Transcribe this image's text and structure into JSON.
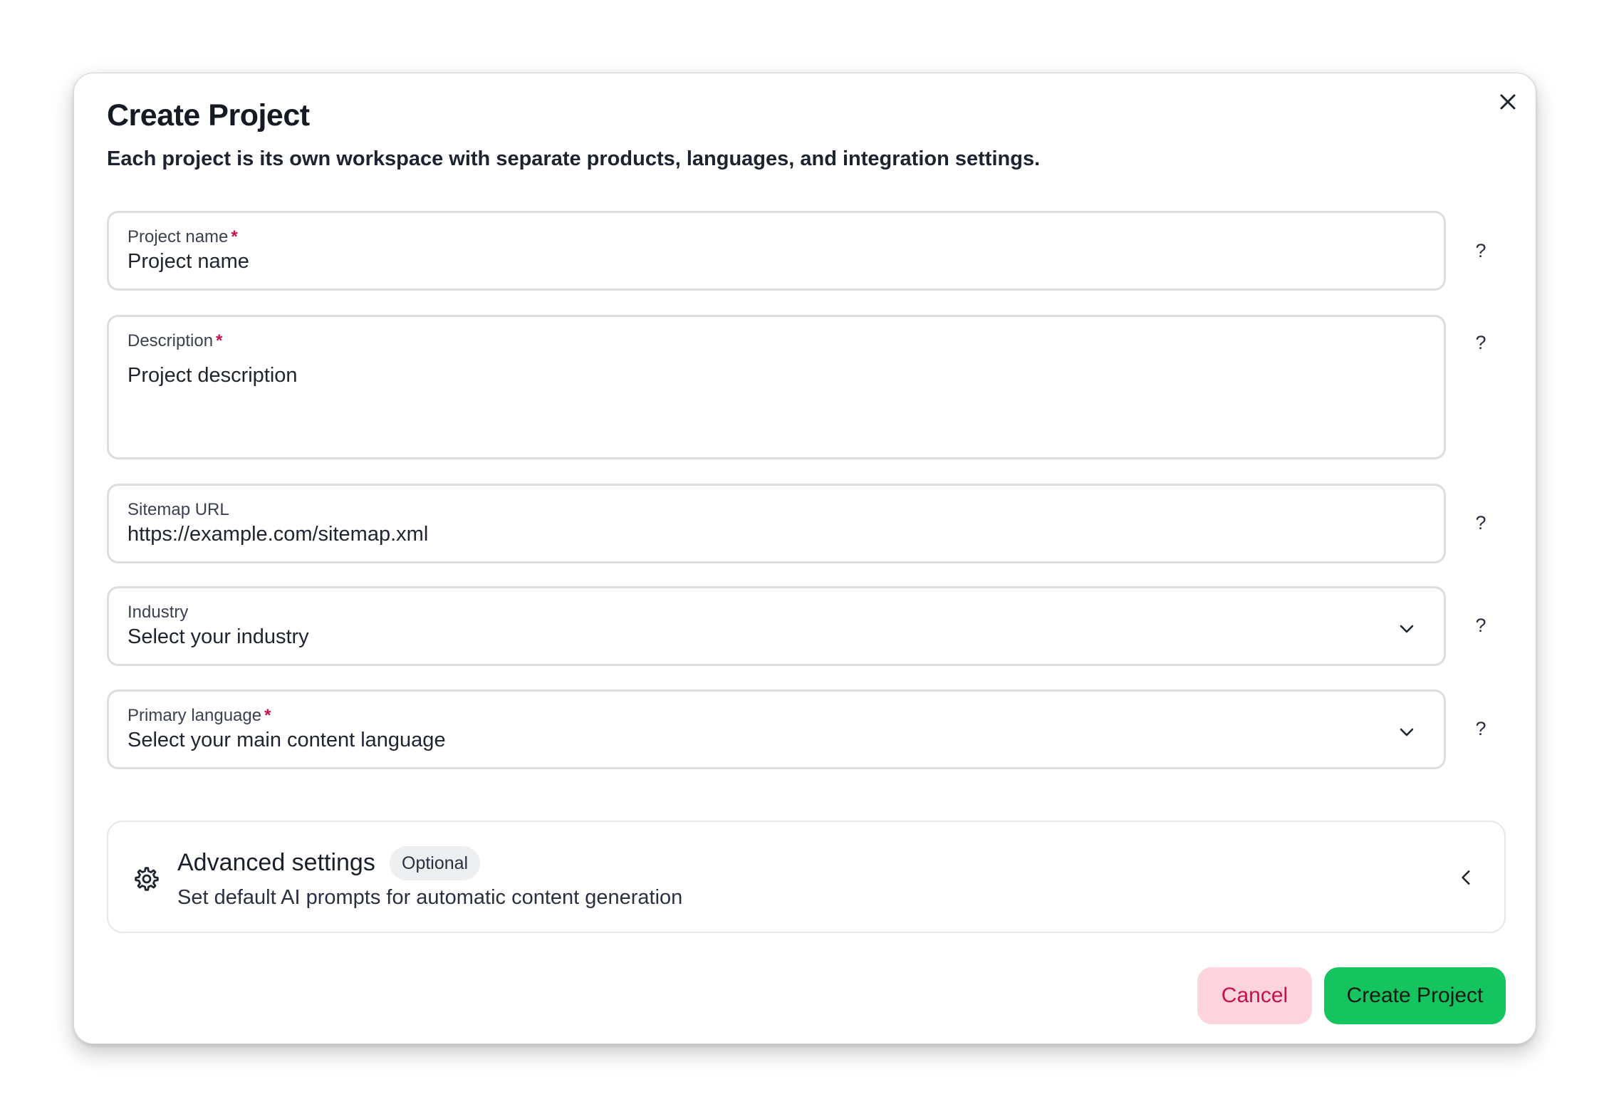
{
  "dialog": {
    "title": "Create Project",
    "subtitle": "Each project is its own workspace with separate products, languages, and integration settings."
  },
  "fields": {
    "project_name": {
      "label": "Project name",
      "required": "*",
      "placeholder": "Project name"
    },
    "description": {
      "label": "Description",
      "required": "*",
      "placeholder": "Project description"
    },
    "sitemap_url": {
      "label": "Sitemap URL",
      "placeholder": "https://example.com/sitemap.xml"
    },
    "industry": {
      "label": "Industry",
      "placeholder": "Select your industry"
    },
    "primary_language": {
      "label": "Primary language",
      "required": "*",
      "placeholder": "Select your main content language"
    }
  },
  "help_label": "?",
  "advanced": {
    "title": "Advanced settings",
    "badge": "Optional",
    "description": "Set default AI prompts for automatic content generation"
  },
  "actions": {
    "cancel": "Cancel",
    "create": "Create Project"
  },
  "colors": {
    "accent_green": "#14c45f",
    "cancel_bg": "#fdd3de",
    "cancel_text": "#c8104e",
    "required": "#c8104e"
  },
  "icons": {
    "close": "close-icon",
    "chevron_down": "chevron-down-icon",
    "gear": "gear-icon",
    "chevron_left": "chevron-left-icon"
  }
}
